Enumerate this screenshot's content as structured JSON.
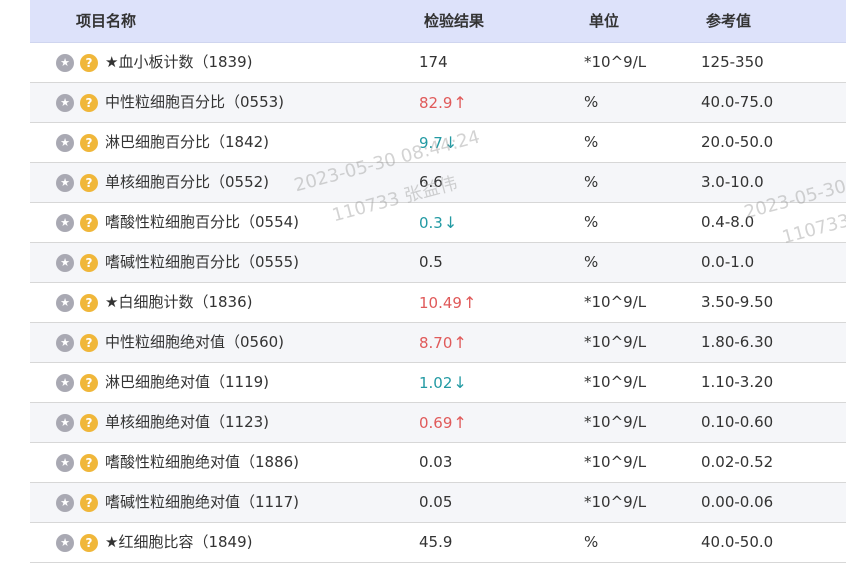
{
  "header": {
    "name": "项目名称",
    "result": "检验结果",
    "unit": "单位",
    "ref": "参考值"
  },
  "icons": {
    "star": "star-icon",
    "help": "help-question-icon",
    "star_glyph": "★",
    "help_glyph": "?"
  },
  "colors": {
    "header_bg": "#dde2fa",
    "high": "#e05a5a",
    "low": "#239aa3",
    "help": "#f0b73a"
  },
  "rows": [
    {
      "name": "★血小板计数（1839)",
      "result": "174",
      "flag": "",
      "unit": "*10^9/L",
      "ref": "125-350"
    },
    {
      "name": "中性粒细胞百分比（0553)",
      "result": "82.9",
      "flag": "↑",
      "unit": "%",
      "ref": "40.0-75.0"
    },
    {
      "name": "淋巴细胞百分比（1842)",
      "result": "9.7",
      "flag": "↓",
      "unit": "%",
      "ref": "20.0-50.0"
    },
    {
      "name": "单核细胞百分比（0552)",
      "result": "6.6",
      "flag": "",
      "unit": "%",
      "ref": "3.0-10.0"
    },
    {
      "name": "嗜酸性粒细胞百分比（0554)",
      "result": "0.3",
      "flag": "↓",
      "unit": "%",
      "ref": "0.4-8.0"
    },
    {
      "name": "嗜碱性粒细胞百分比（0555)",
      "result": "0.5",
      "flag": "",
      "unit": "%",
      "ref": "0.0-1.0"
    },
    {
      "name": "★白细胞计数（1836)",
      "result": "10.49",
      "flag": "↑",
      "unit": "*10^9/L",
      "ref": "3.50-9.50"
    },
    {
      "name": "中性粒细胞绝对值（0560)",
      "result": "8.70",
      "flag": "↑",
      "unit": "*10^9/L",
      "ref": "1.80-6.30"
    },
    {
      "name": "淋巴细胞绝对值（1119)",
      "result": "1.02",
      "flag": "↓",
      "unit": "*10^9/L",
      "ref": "1.10-3.20"
    },
    {
      "name": "单核细胞绝对值（1123)",
      "result": "0.69",
      "flag": "↑",
      "unit": "*10^9/L",
      "ref": "0.10-0.60"
    },
    {
      "name": "嗜酸性粒细胞绝对值（1886)",
      "result": "0.03",
      "flag": "",
      "unit": "*10^9/L",
      "ref": "0.02-0.52"
    },
    {
      "name": "嗜碱性粒细胞绝对值（1117)",
      "result": "0.05",
      "flag": "",
      "unit": "*10^9/L",
      "ref": "0.00-0.06"
    },
    {
      "name": "★红细胞比容（1849)",
      "result": "45.9",
      "flag": "",
      "unit": "%",
      "ref": "40.0-50.0"
    }
  ],
  "watermark": {
    "line1": "2023-05-30 08:44:24",
    "line2": "110733 张益伟",
    "line1_partial": "2023-05-30",
    "line2_partial": "110733"
  }
}
